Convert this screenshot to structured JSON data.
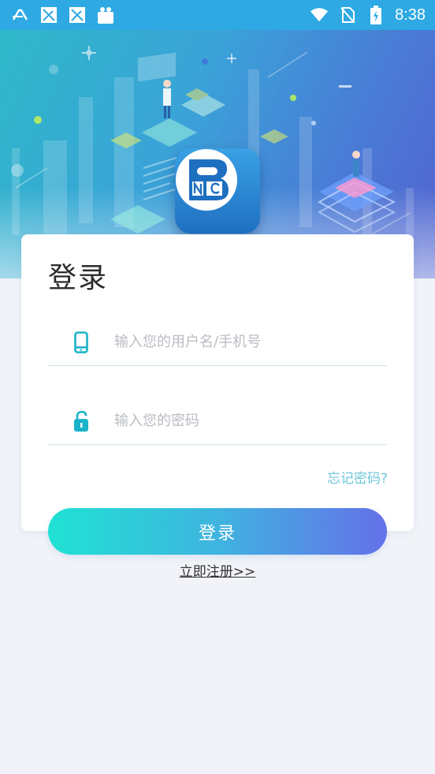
{
  "status_bar": {
    "time": "8:38",
    "icons": [
      "app-font-icon",
      "notification-image-icon",
      "notification-image-icon",
      "shopping-bag-icon",
      "wifi-icon",
      "no-sim-icon",
      "battery-charging-icon"
    ]
  },
  "login": {
    "title": "登录",
    "username_placeholder": "输入您的用户名/手机号",
    "password_placeholder": "输入您的密码",
    "forgot_label": "忘记密码?",
    "submit_label": "登录",
    "register_label": "立即注册>>"
  },
  "colors": {
    "status_bar": "#2ea9e3",
    "accent": "#1ab3c9",
    "button_start": "#1fe2d3",
    "button_end": "#6570e9",
    "link": "#6fc6d9"
  }
}
